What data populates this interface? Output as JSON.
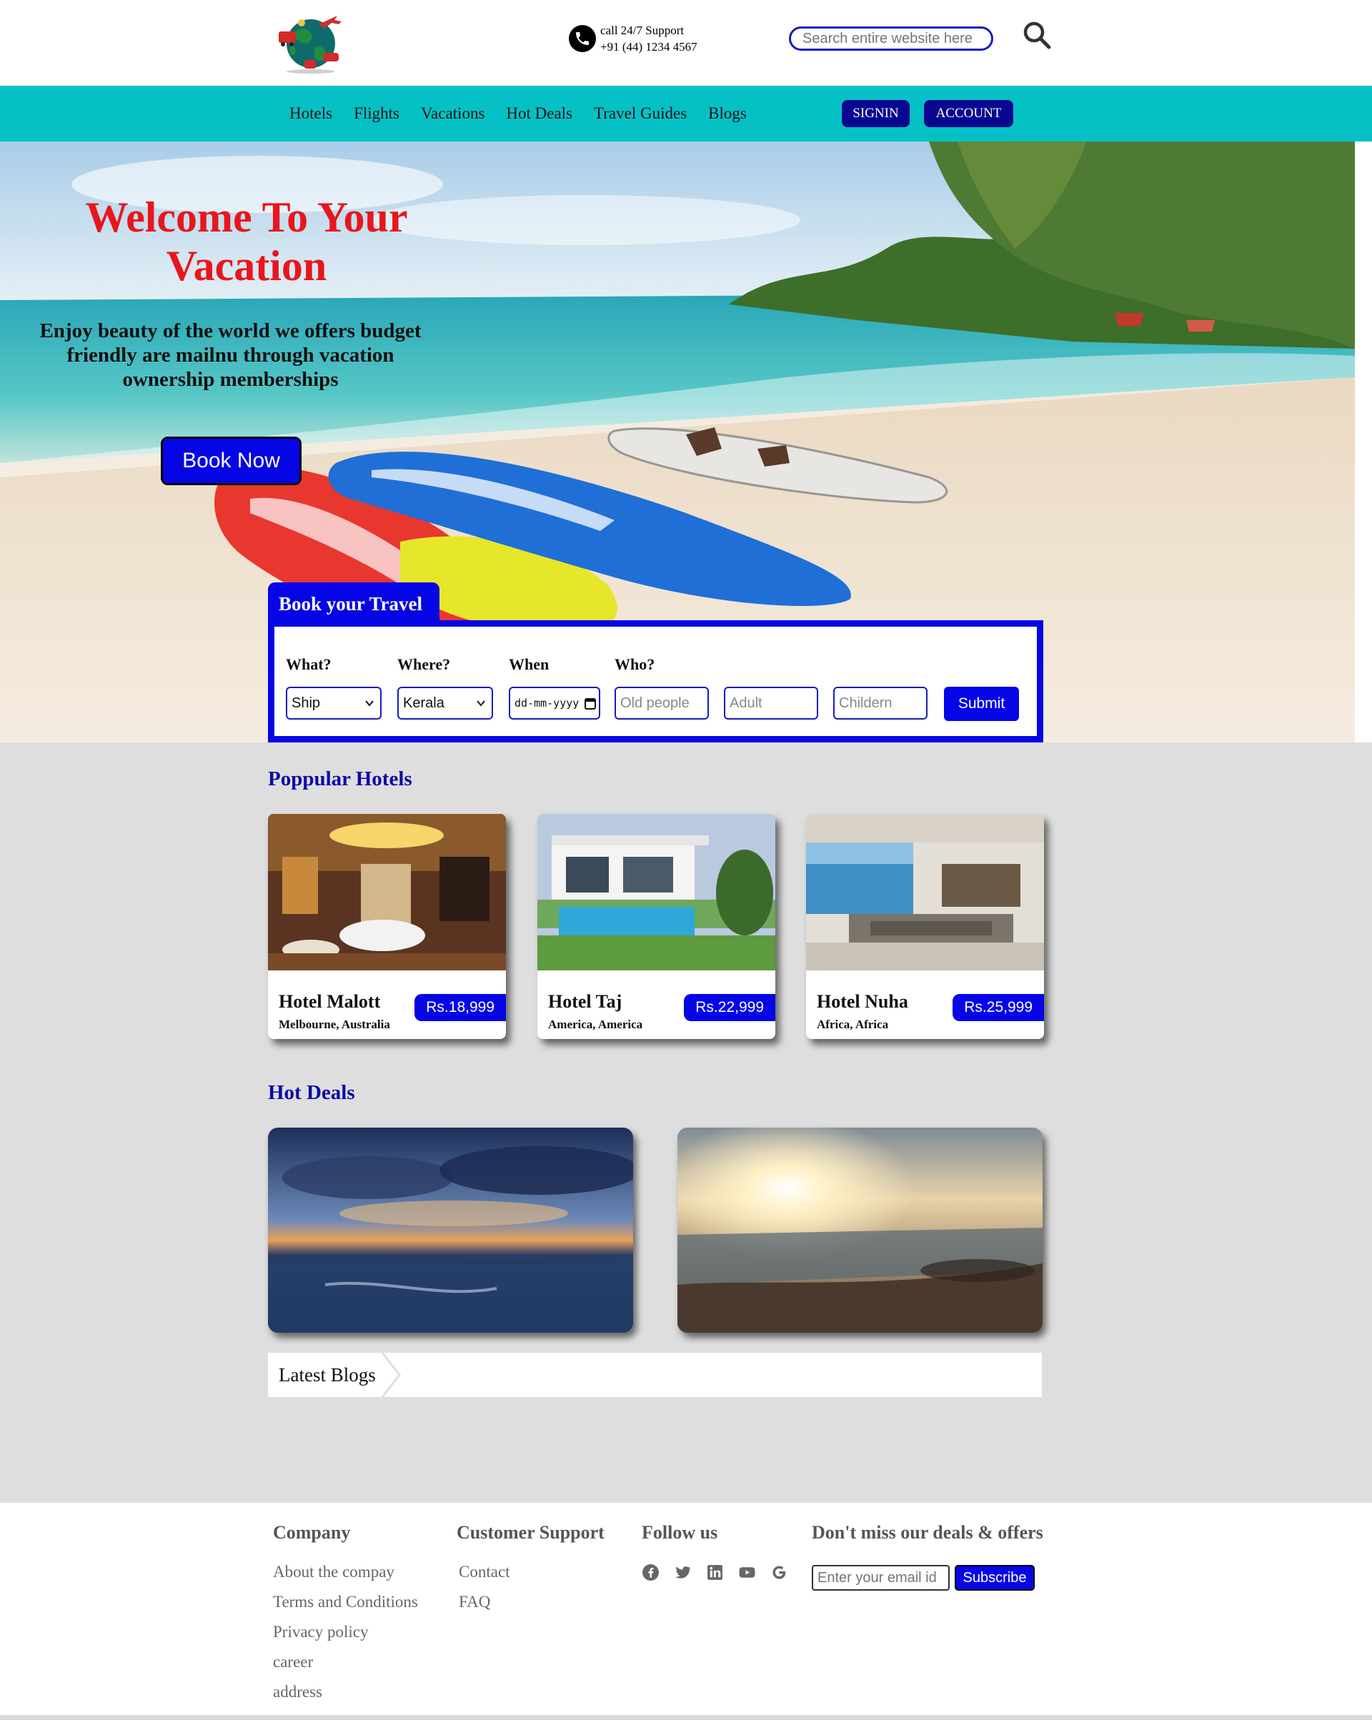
{
  "header": {
    "support_line1": "call 24/7 Support",
    "support_line2": "+91 (44) 1234 4567",
    "search_placeholder": "Search entire website here"
  },
  "nav": {
    "links": [
      "Hotels",
      "Flights",
      "Vacations",
      "Hot Deals",
      "Travel Guides",
      "Blogs"
    ],
    "signin_label": "SIGNIN",
    "account_label": "ACCOUNT"
  },
  "hero": {
    "title": "Welcome To Your Vacation",
    "subtitle": "Enjoy beauty of the world we offers budget friendly are mailnu through vacation ownership memberships",
    "cta_label": "Book Now"
  },
  "booking": {
    "tab_title": "Book your Travel",
    "what_label": "What?",
    "where_label": "Where?",
    "when_label": "When",
    "who_label": "Who?",
    "what_value": "Ship",
    "where_value": "Kerala",
    "date_placeholder": "dd-mm-yyyy",
    "old_people_placeholder": "Old people",
    "adult_placeholder": "Adult",
    "children_placeholder": "Childern",
    "submit_label": "Submit"
  },
  "popular_hotels": {
    "title": "Poppular Hotels",
    "items": [
      {
        "name": "Hotel Malott",
        "location": "Melbourne, Australia",
        "price": "Rs.18,999"
      },
      {
        "name": "Hotel Taj",
        "location": "America, America",
        "price": "Rs.22,999"
      },
      {
        "name": "Hotel Nuha",
        "location": "Africa, Africa",
        "price": "Rs.25,999"
      }
    ]
  },
  "hot_deals": {
    "title": "Hot Deals"
  },
  "blogs": {
    "label": "Latest Blogs"
  },
  "footer": {
    "company": {
      "heading": "Company",
      "links": [
        "About the compay",
        "Terms and Conditions",
        "Privacy policy",
        "career",
        "address"
      ]
    },
    "support": {
      "heading": "Customer Support",
      "links": [
        "Contact",
        "FAQ"
      ]
    },
    "follow": {
      "heading": "Follow us",
      "icons": [
        "facebook-icon",
        "twitter-icon",
        "linkedin-icon",
        "youtube-icon",
        "google-icon"
      ]
    },
    "newsletter": {
      "heading": "Don't miss our deals & offers",
      "email_placeholder": "Enter your email id",
      "subscribe_label": "Subscribe"
    }
  },
  "colors": {
    "nav_bg": "#05c1c6",
    "primary_blue": "#0505e6",
    "dark_button": "#070790",
    "hero_title": "#e8161c",
    "section_title": "#0a0aa8",
    "main_bg": "#dedede"
  }
}
